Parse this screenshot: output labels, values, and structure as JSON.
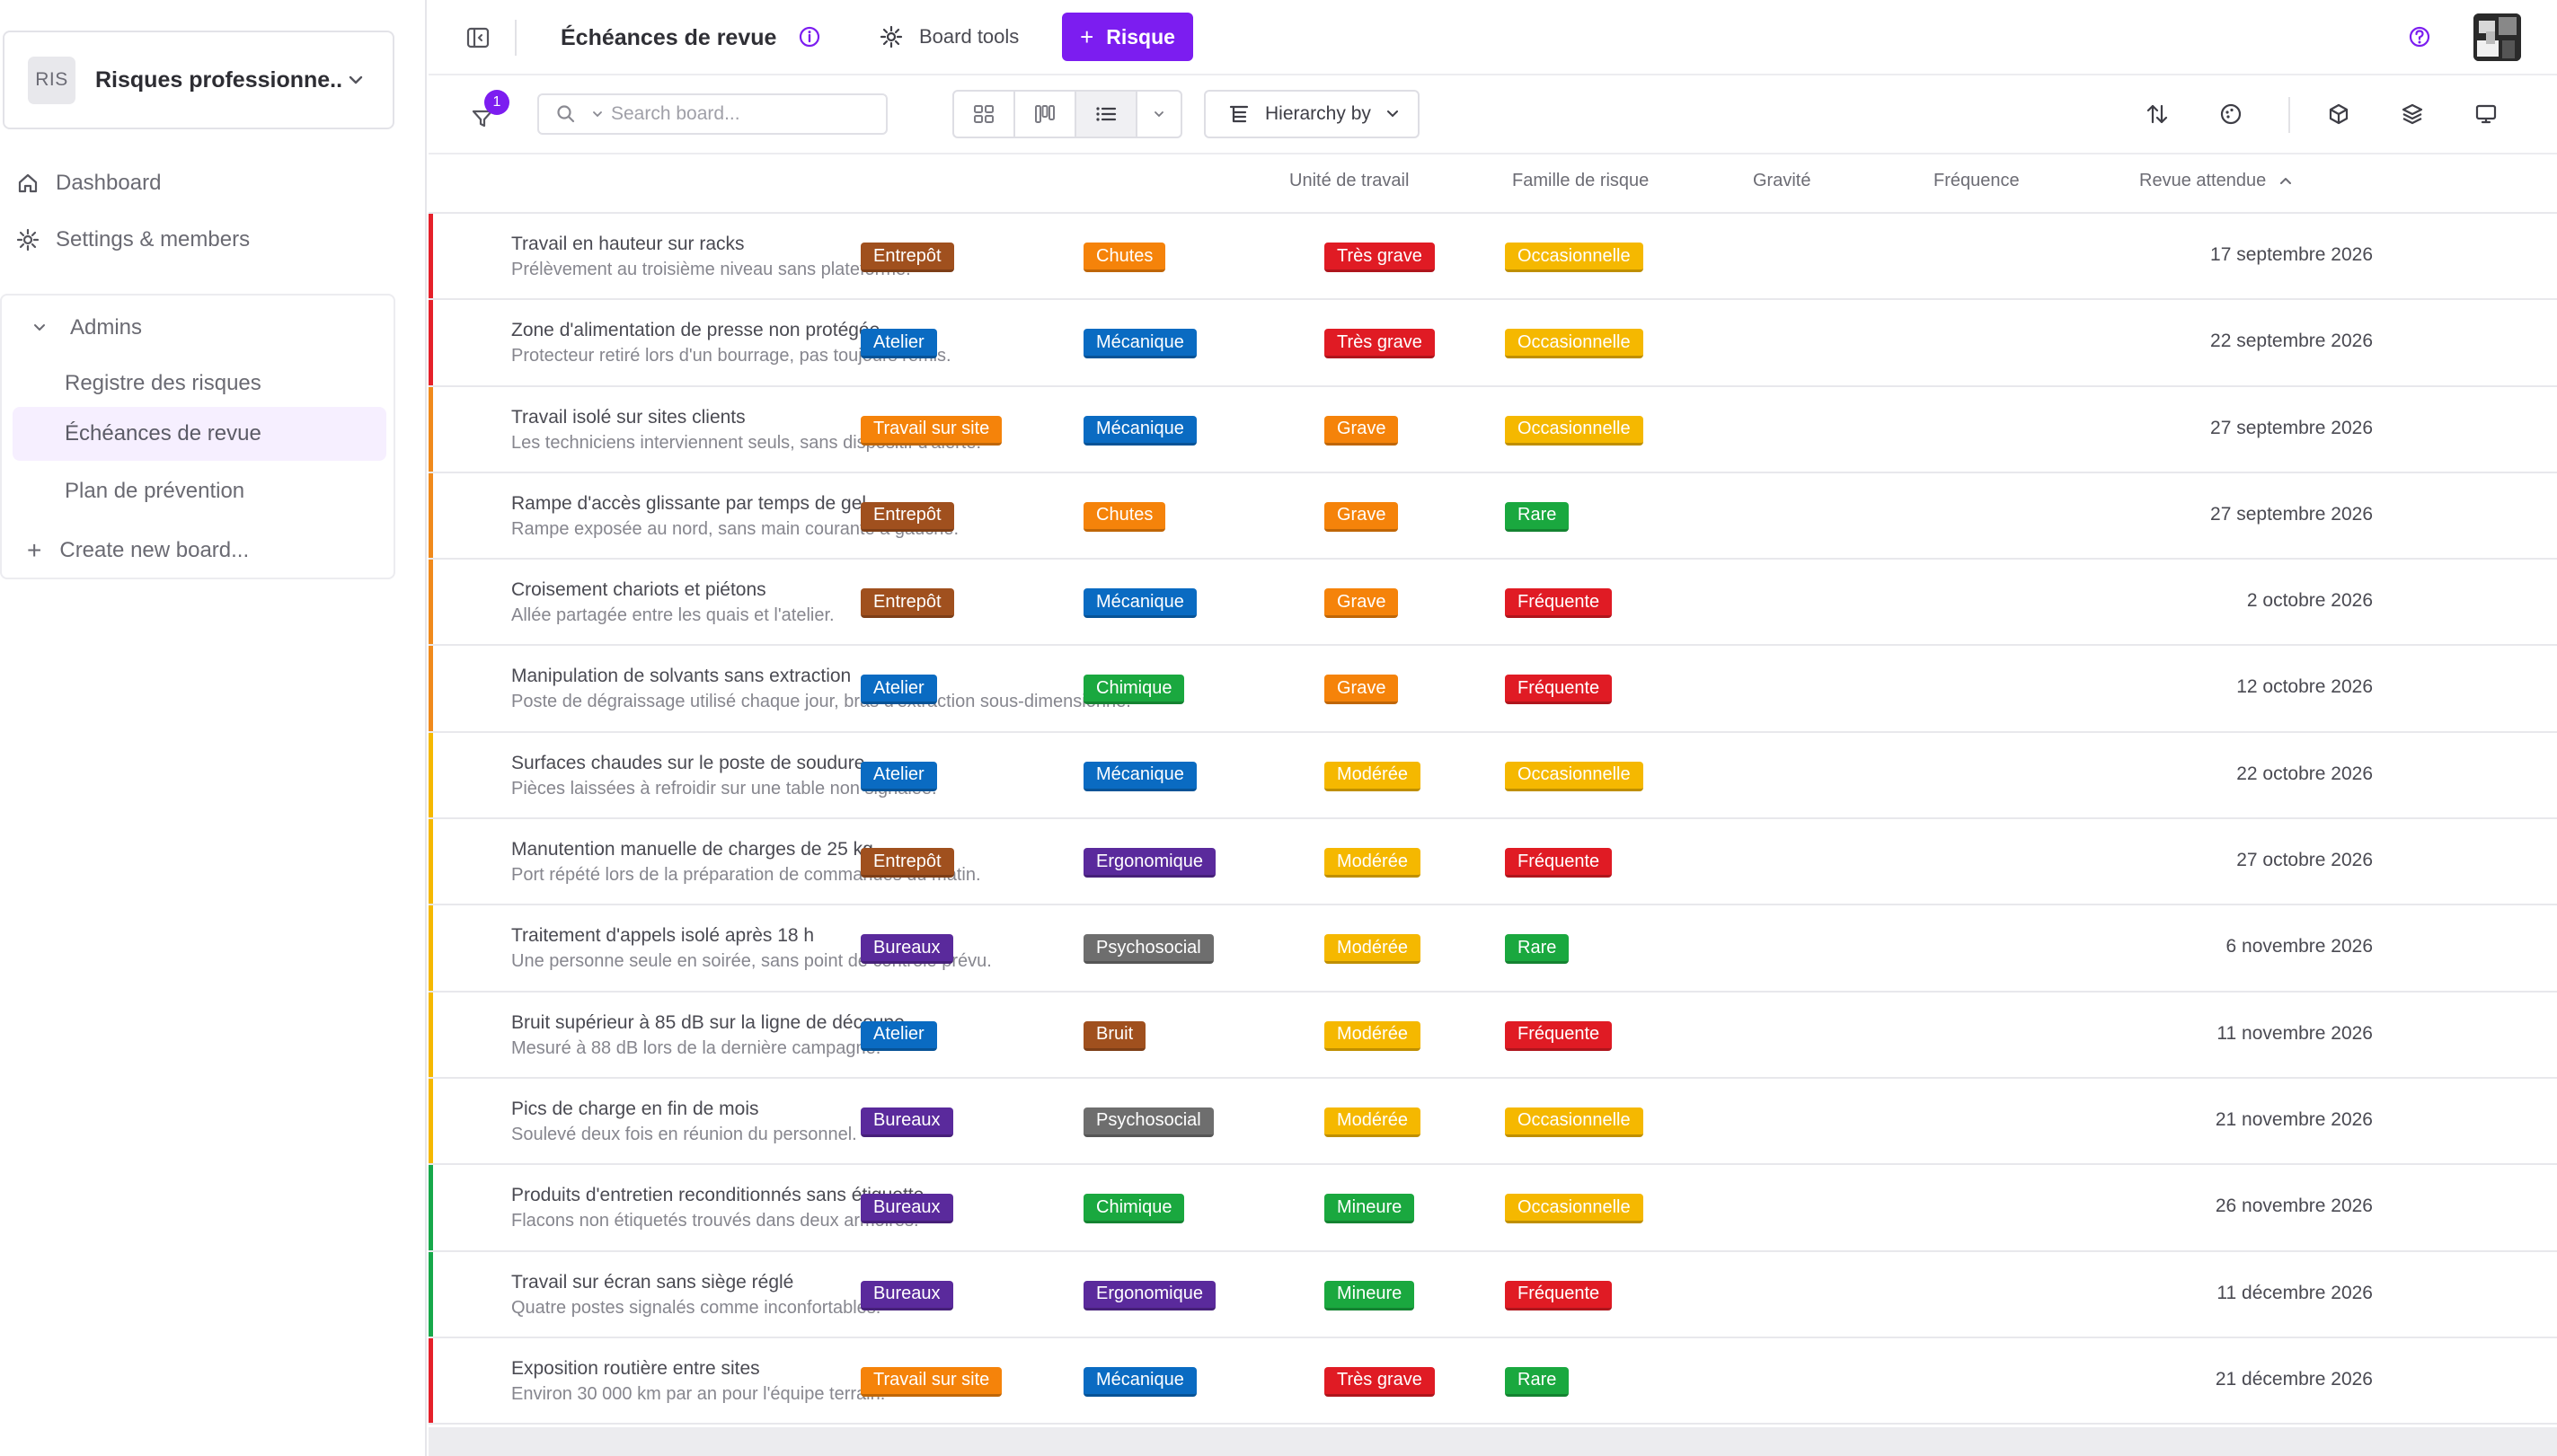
{
  "workspace": {
    "initials": "RIS",
    "name": "Risques professionne..."
  },
  "sidebar": {
    "dashboard_label": "Dashboard",
    "settings_label": "Settings & members",
    "group_label": "Admins",
    "boards": [
      {
        "label": "Registre des risques",
        "active": false
      },
      {
        "label": "Échéances de revue",
        "active": true
      },
      {
        "label": "Plan de prévention",
        "active": false
      }
    ],
    "create_board_label": "Create new board..."
  },
  "topbar": {
    "title": "Échéances de revue",
    "board_tools_label": "Board tools",
    "add_button_label": "Risque"
  },
  "toolbar": {
    "filter_count": "1",
    "search_placeholder": "Search board...",
    "hierarchy_label": "Hierarchy by"
  },
  "table": {
    "columns": [
      "Unité de travail",
      "Famille de risque",
      "Gravité",
      "Fréquence",
      "Revue attendue"
    ],
    "sort_column": "Revue attendue",
    "sort_direction": "ascending",
    "rows": [
      {
        "title": "Travail en hauteur sur racks",
        "desc": "Prélèvement au troisième niveau sans plateforme.",
        "unit": "Entrepôt",
        "family": "Chutes",
        "severity": "Très grave",
        "frequency": "Occasionnelle",
        "date": "17 septembre 2026",
        "accent": "#e5202a"
      },
      {
        "title": "Zone d'alimentation de presse non protégée",
        "desc": "Protecteur retiré lors d'un bourrage, pas toujours remis.",
        "unit": "Atelier",
        "family": "Mécanique",
        "severity": "Très grave",
        "frequency": "Occasionnelle",
        "date": "22 septembre 2026",
        "accent": "#e5202a"
      },
      {
        "title": "Travail isolé sur sites clients",
        "desc": "Les techniciens interviennent seuls, sans dispositif d'alerte.",
        "unit": "Travail sur site",
        "family": "Mécanique",
        "severity": "Grave",
        "frequency": "Occasionnelle",
        "date": "27 septembre 2026",
        "accent": "#f08a1c"
      },
      {
        "title": "Rampe d'accès glissante par temps de gel",
        "desc": "Rampe exposée au nord, sans main courante à gauche.",
        "unit": "Entrepôt",
        "family": "Chutes",
        "severity": "Grave",
        "frequency": "Rare",
        "date": "27 septembre 2026",
        "accent": "#f08a1c"
      },
      {
        "title": "Croisement chariots et piétons",
        "desc": "Allée partagée entre les quais et l'atelier.",
        "unit": "Entrepôt",
        "family": "Mécanique",
        "severity": "Grave",
        "frequency": "Fréquente",
        "date": "2 octobre 2026",
        "accent": "#f08a1c"
      },
      {
        "title": "Manipulation de solvants sans extraction",
        "desc": "Poste de dégraissage utilisé chaque jour, bras d'extraction sous-dimensionné.",
        "unit": "Atelier",
        "family": "Chimique",
        "severity": "Grave",
        "frequency": "Fréquente",
        "date": "12 octobre 2026",
        "accent": "#f08a1c"
      },
      {
        "title": "Surfaces chaudes sur le poste de soudure",
        "desc": "Pièces laissées à refroidir sur une table non signalée.",
        "unit": "Atelier",
        "family": "Mécanique",
        "severity": "Modérée",
        "frequency": "Occasionnelle",
        "date": "22 octobre 2026",
        "accent": "#f5b800"
      },
      {
        "title": "Manutention manuelle de charges de 25 kg",
        "desc": "Port répété lors de la préparation de commandes du matin.",
        "unit": "Entrepôt",
        "family": "Ergonomique",
        "severity": "Modérée",
        "frequency": "Fréquente",
        "date": "27 octobre 2026",
        "accent": "#f5b800"
      },
      {
        "title": "Traitement d'appels isolé après 18 h",
        "desc": "Une personne seule en soirée, sans point de contrôle prévu.",
        "unit": "Bureaux",
        "family": "Psychosocial",
        "severity": "Modérée",
        "frequency": "Rare",
        "date": "6 novembre 2026",
        "accent": "#f5b800"
      },
      {
        "title": "Bruit supérieur à 85 dB sur la ligne de découpe",
        "desc": "Mesuré à 88 dB lors de la dernière campagne.",
        "unit": "Atelier",
        "family": "Bruit",
        "severity": "Modérée",
        "frequency": "Fréquente",
        "date": "11 novembre 2026",
        "accent": "#f5b800"
      },
      {
        "title": "Pics de charge en fin de mois",
        "desc": "Soulevé deux fois en réunion du personnel.",
        "unit": "Bureaux",
        "family": "Psychosocial",
        "severity": "Modérée",
        "frequency": "Occasionnelle",
        "date": "21 novembre 2026",
        "accent": "#f5b800"
      },
      {
        "title": "Produits d'entretien reconditionnés sans étiquette",
        "desc": "Flacons non étiquetés trouvés dans deux armoires.",
        "unit": "Bureaux",
        "family": "Chimique",
        "severity": "Mineure",
        "frequency": "Occasionnelle",
        "date": "26 novembre 2026",
        "accent": "#16a84a"
      },
      {
        "title": "Travail sur écran sans siège réglé",
        "desc": "Quatre postes signalés comme inconfortables.",
        "unit": "Bureaux",
        "family": "Ergonomique",
        "severity": "Mineure",
        "frequency": "Fréquente",
        "date": "11 décembre 2026",
        "accent": "#16a84a"
      },
      {
        "title": "Exposition routière entre sites",
        "desc": "Environ 30 000 km par an pour l'équipe terrain.",
        "unit": "Travail sur site",
        "family": "Mécanique",
        "severity": "Très grave",
        "frequency": "Rare",
        "date": "21 décembre 2026",
        "accent": "#e5202a"
      }
    ]
  },
  "tag_colors": {
    "Entrepôt": "#a0501e",
    "Atelier": "#0a6bc2",
    "Travail sur site": "#f5830a",
    "Bureaux": "#5a2a9c",
    "Chutes": "#f5830a",
    "Mécanique": "#0a6bc2",
    "Chimique": "#1aa83f",
    "Ergonomique": "#5a2a9c",
    "Psychosocial": "#6e6e6e",
    "Bruit": "#a0501e",
    "Très grave": "#e01b24",
    "Grave": "#f5830a",
    "Modérée": "#f5b800",
    "Mineure": "#1aa83f",
    "Occasionnelle": "#f5b800",
    "Rare": "#1aa83f",
    "Fréquente": "#e01b24"
  },
  "accent_color": "#7c1df0"
}
